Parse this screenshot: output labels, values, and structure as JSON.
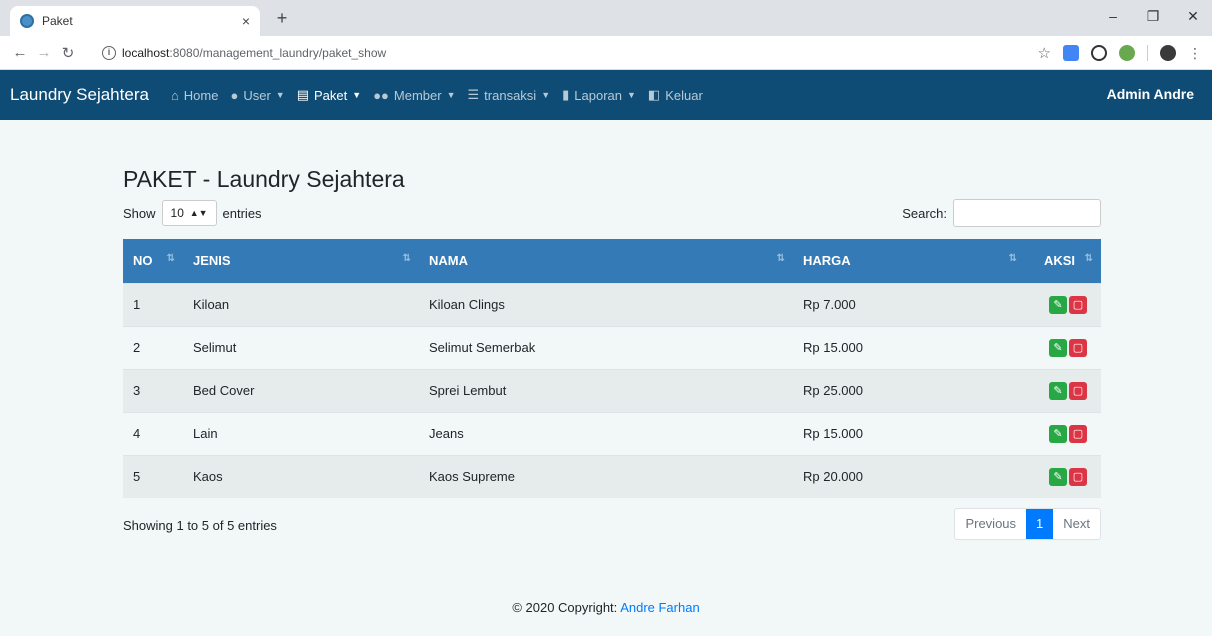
{
  "browser": {
    "tab_title": "Paket",
    "tab_close": "×",
    "new_tab": "+",
    "url_host": "localhost",
    "url_rest": ":8080/management_laundry/paket_show"
  },
  "navbar": {
    "brand": "Laundry Sejahtera",
    "items": [
      {
        "label": "Home",
        "icon": "home-icon",
        "caret": false
      },
      {
        "label": "User",
        "icon": "user-icon",
        "caret": true
      },
      {
        "label": "Paket",
        "icon": "briefcase-icon",
        "caret": true
      },
      {
        "label": "Member",
        "icon": "users-icon",
        "caret": true
      },
      {
        "label": "transaksi",
        "icon": "cart-icon",
        "caret": true
      },
      {
        "label": "Laporan",
        "icon": "file-icon",
        "caret": true
      },
      {
        "label": "Keluar",
        "icon": "door-icon",
        "caret": false
      }
    ],
    "admin": "Admin Andre",
    "bg_color": "#0f4c75"
  },
  "main": {
    "title": "PAKET - Laundry Sejahtera",
    "show_label": "Show",
    "entries_select": "10",
    "entries_label": "entries",
    "search_label": "Search:",
    "table": {
      "headers": [
        "NO",
        "JENIS",
        "NAMA",
        "HARGA",
        "AKSI"
      ],
      "rows": [
        [
          "1",
          "Kiloan",
          "Kiloan Clings",
          "Rp 7.000"
        ],
        [
          "2",
          "Selimut",
          "Selimut Semerbak",
          "Rp 15.000"
        ],
        [
          "3",
          "Bed Cover",
          "Sprei Lembut",
          "Rp 25.000"
        ],
        [
          "4",
          "Lain",
          "Jeans",
          "Rp 15.000"
        ],
        [
          "5",
          "Kaos",
          "Kaos Supreme",
          "Rp 20.000"
        ]
      ]
    },
    "info": "Showing 1 to 5 of 5 entries",
    "pager": {
      "previous": "Previous",
      "current": "1",
      "next": "Next"
    }
  },
  "footer": {
    "prefix": "© 2020 Copyright: ",
    "author": "Andre Farhan"
  },
  "colors": {
    "header_blue": "#337ab7",
    "edit_green": "#28a745",
    "delete_red": "#dc3545",
    "accent": "#007bff"
  }
}
